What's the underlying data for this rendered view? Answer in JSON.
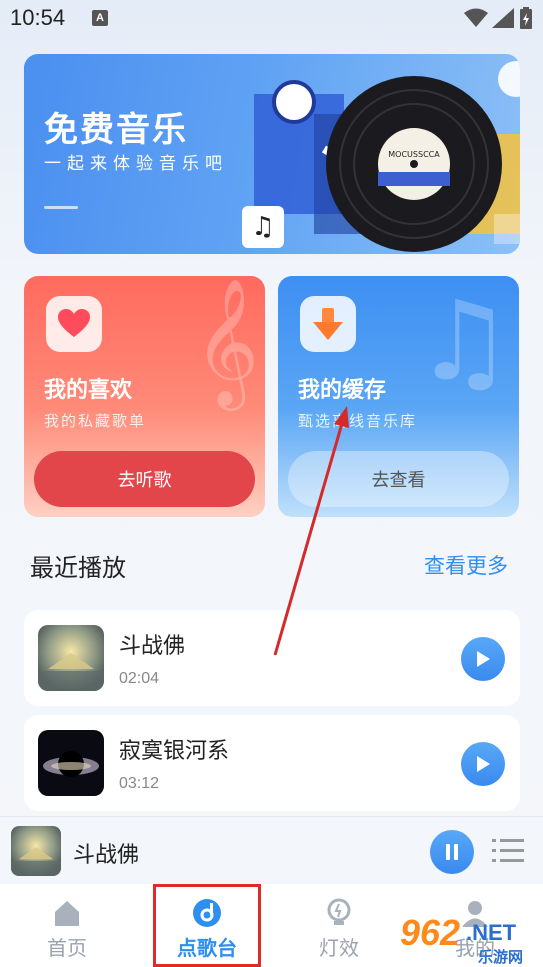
{
  "status_bar": {
    "time": "10:54",
    "notif_glyph": "A"
  },
  "banner": {
    "title": "免费音乐",
    "subtitle": "一起来体验音乐吧",
    "record_label_text": "MOCUSSCCA"
  },
  "cards": [
    {
      "title": "我的喜欢",
      "subtitle": "我的私藏歌单",
      "button": "去听歌",
      "icon": "heart-icon"
    },
    {
      "title": "我的缓存",
      "subtitle": "甄选离线音乐库",
      "button": "去查看",
      "icon": "download-icon"
    }
  ],
  "recent": {
    "title": "最近播放",
    "more": "查看更多",
    "songs": [
      {
        "name": "斗战佛",
        "duration": "02:04"
      },
      {
        "name": "寂寞银河系",
        "duration": "03:12"
      }
    ]
  },
  "mini_player": {
    "song": "斗战佛",
    "state": "playing"
  },
  "nav": [
    {
      "label": "首页",
      "icon": "home-icon",
      "active": false
    },
    {
      "label": "点歌台",
      "icon": "music-disc-icon",
      "active": true
    },
    {
      "label": "灯效",
      "icon": "bulb-icon",
      "active": false
    },
    {
      "label": "我的",
      "icon": "user-icon",
      "active": false
    }
  ],
  "watermark": {
    "text": "962",
    "suffix": ".NET",
    "sub": "乐游网"
  },
  "colors": {
    "accent": "#2f8ff0",
    "fav_card": "#ff6a5e",
    "cache_card": "#3d8ff2",
    "annotation": "#e12a2a"
  }
}
